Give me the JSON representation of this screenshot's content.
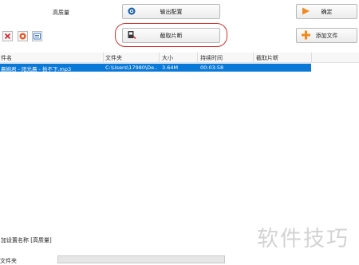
{
  "top": {
    "quality_label": "高质量",
    "output_config_label": "输出配置",
    "ok_label": "确定",
    "clip_label": "截取片断",
    "add_file_label": "添加文件"
  },
  "table": {
    "headers": [
      "件名",
      "文件夹",
      "大小",
      "持续时间",
      "截取片断"
    ],
    "rows": [
      {
        "name": "晨婉君 - 阳光晨 - 拾不下.mp3",
        "folder": "C:\\Users\\17980\\De...",
        "size": "3.64M",
        "duration": "00:03:58",
        "clip": ""
      }
    ]
  },
  "bottom": {
    "preset_label": "加设置名称 [高质量]",
    "folder_label": "文件夹"
  },
  "watermark": "软件技巧",
  "colors": {
    "selection": "#0a78d7",
    "highlight": "#d2342e",
    "accent_orange": "#f08a1c"
  }
}
